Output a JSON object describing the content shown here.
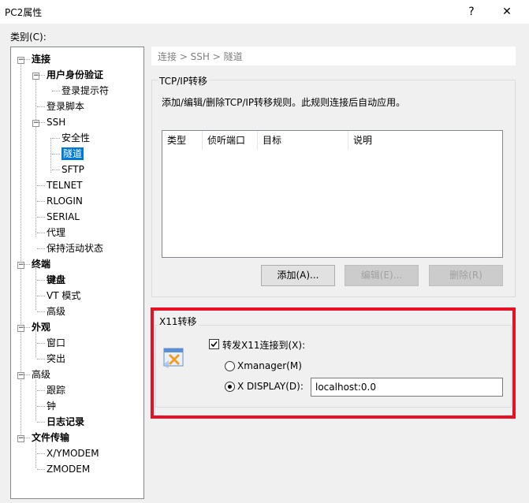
{
  "window": {
    "title": "PC2属性",
    "help_btn": "?",
    "close_btn": "✕"
  },
  "category_label": "类别(C):",
  "tree": {
    "items": [
      {
        "label": "连接",
        "bold": true,
        "expander": "−"
      },
      {
        "label": "用户身份验证",
        "bold": true,
        "expander": "−"
      },
      {
        "label": "登录提示符"
      },
      {
        "label": "登录脚本"
      },
      {
        "label": "SSH",
        "expander": "−"
      },
      {
        "label": "安全性"
      },
      {
        "label": "隧道",
        "selected": true
      },
      {
        "label": "SFTP"
      },
      {
        "label": "TELNET"
      },
      {
        "label": "RLOGIN"
      },
      {
        "label": "SERIAL"
      },
      {
        "label": "代理"
      },
      {
        "label": "保持活动状态"
      },
      {
        "label": "终端",
        "bold": true,
        "expander": "−"
      },
      {
        "label": "键盘",
        "bold": true
      },
      {
        "label": "VT 模式"
      },
      {
        "label": "高级"
      },
      {
        "label": "外观",
        "bold": true,
        "expander": "−"
      },
      {
        "label": "窗口"
      },
      {
        "label": "突出"
      },
      {
        "label": "高级",
        "expander": "−"
      },
      {
        "label": "跟踪"
      },
      {
        "label": "钟"
      },
      {
        "label": "日志记录",
        "bold": true
      },
      {
        "label": "文件传输",
        "bold": true,
        "expander": "−"
      },
      {
        "label": "X/YMODEM"
      },
      {
        "label": "ZMODEM"
      }
    ]
  },
  "breadcrumb": "连接 > SSH > 隧道",
  "tcpip": {
    "title": "TCP/IP转移",
    "description": "添加/编辑/删除TCP/IP转移规则。此规则连接后自动应用。",
    "columns": [
      "类型",
      "侦听端口",
      "目标",
      "说明"
    ],
    "add_button": "添加(A)...",
    "edit_button": "编辑(E)...",
    "delete_button": "删除(R)"
  },
  "x11": {
    "title": "X11转移",
    "forward_label": "转发X11连接到(X):",
    "forward_checked": true,
    "xmanager_label": "Xmanager(M)",
    "xdisplay_label": "X DISPLAY(D):",
    "xdisplay_value": "localhost:0.0",
    "selected": "X DISPLAY(D):",
    "highlight_color": "#e81123"
  },
  "colors": {
    "selection": "#0078d7",
    "dialog_bg": "#f0f0f0"
  }
}
